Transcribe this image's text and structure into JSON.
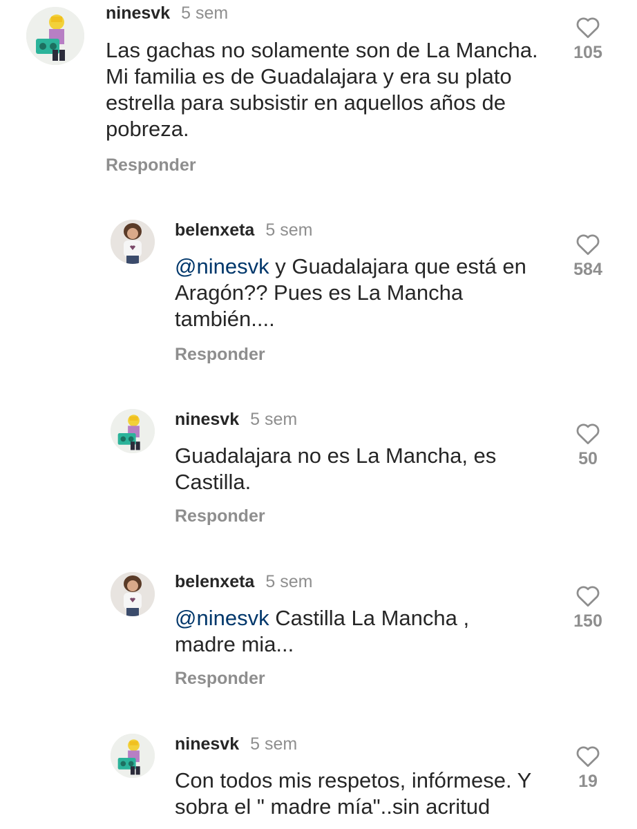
{
  "comments": [
    {
      "username": "ninesvk",
      "time": "5 sem",
      "mention": "",
      "text": "Las gachas no solamente son de La Mancha. Mi familia es de Guadalajara y era su plato estrella para subsistir en aquellos años de pobreza.",
      "reply_label": "Responder",
      "likes": "105",
      "avatar": "lego-icon"
    },
    {
      "username": "belenxeta",
      "time": "5 sem",
      "mention": "@ninesvk",
      "text": "y Guadalajara que está en Aragón?? Pues es La Mancha también....",
      "reply_label": "Responder",
      "likes": "584",
      "avatar": "person-photo"
    },
    {
      "username": "ninesvk",
      "time": "5 sem",
      "mention": "",
      "text": "Guadalajara no es La Mancha, es Castilla.",
      "reply_label": "Responder",
      "likes": "50",
      "avatar": "lego-icon"
    },
    {
      "username": "belenxeta",
      "time": "5 sem",
      "mention": "@ninesvk",
      "text": "Castilla La Mancha , madre mia...",
      "reply_label": "Responder",
      "likes": "150",
      "avatar": "person-photo"
    },
    {
      "username": "ninesvk",
      "time": "5 sem",
      "mention": "",
      "text": "Con todos mis respetos, infórmese. Y sobra el \" madre mía\"..sin acritud",
      "reply_label": "",
      "likes": "19",
      "avatar": "lego-icon"
    }
  ],
  "colors": {
    "text": "#262626",
    "secondary": "#8e8e8e",
    "mention": "#00376b"
  }
}
